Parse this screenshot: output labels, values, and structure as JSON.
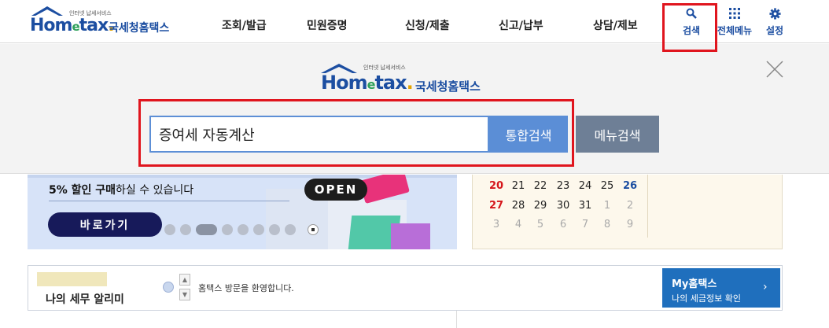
{
  "brand": {
    "sub": "인터넷 납세서비스",
    "word_prefix": "Hom",
    "word_e": "e",
    "word_suffix": "tax",
    "dot": ".",
    "name": "국세청홈택스"
  },
  "nav": {
    "items": [
      {
        "label": "조회/발급"
      },
      {
        "label": "민원증명"
      },
      {
        "label": "신청/제출"
      },
      {
        "label": "신고/납부"
      },
      {
        "label": "상담/제보"
      }
    ]
  },
  "header_buttons": {
    "search": {
      "icon": "search-icon",
      "label": "검색"
    },
    "menu": {
      "icon": "grid-icon",
      "label": "전체메뉴"
    },
    "settings": {
      "icon": "gear-icon",
      "label": "설정"
    }
  },
  "search": {
    "value": "증여세 자동계산",
    "total_label": "통합검색",
    "menu_label": "메뉴검색"
  },
  "banner": {
    "text_bold1": "5% 할인 구매",
    "text_rest": "하실 수 있습니다",
    "button_label": "바로가기",
    "open_label": "OPEN"
  },
  "calendar": {
    "rows": [
      [
        {
          "d": "20",
          "c": "red"
        },
        {
          "d": "21",
          "c": "norm"
        },
        {
          "d": "22",
          "c": "norm"
        },
        {
          "d": "23",
          "c": "norm"
        },
        {
          "d": "24",
          "c": "norm"
        },
        {
          "d": "25",
          "c": "norm"
        },
        {
          "d": "26",
          "c": "blue"
        }
      ],
      [
        {
          "d": "27",
          "c": "red"
        },
        {
          "d": "28",
          "c": "norm"
        },
        {
          "d": "29",
          "c": "norm"
        },
        {
          "d": "30",
          "c": "norm"
        },
        {
          "d": "31",
          "c": "norm"
        },
        {
          "d": "1",
          "c": "gray"
        },
        {
          "d": "2",
          "c": "gray"
        }
      ],
      [
        {
          "d": "3",
          "c": "gray"
        },
        {
          "d": "4",
          "c": "gray"
        },
        {
          "d": "5",
          "c": "gray"
        },
        {
          "d": "6",
          "c": "gray"
        },
        {
          "d": "7",
          "c": "gray"
        },
        {
          "d": "8",
          "c": "gray"
        },
        {
          "d": "9",
          "c": "gray"
        }
      ]
    ]
  },
  "notice": {
    "title": "나의 세무 알리미",
    "message": "홈택스 방문을 환영합니다.",
    "my_title": "My홈택스",
    "my_sub": "나의 세금정보 확인"
  },
  "colors": {
    "brand_blue": "#1c4ea1",
    "highlight_red": "#e0151e",
    "search_btn": "#5b8ed6",
    "menu_search_btn": "#6e7f96"
  }
}
